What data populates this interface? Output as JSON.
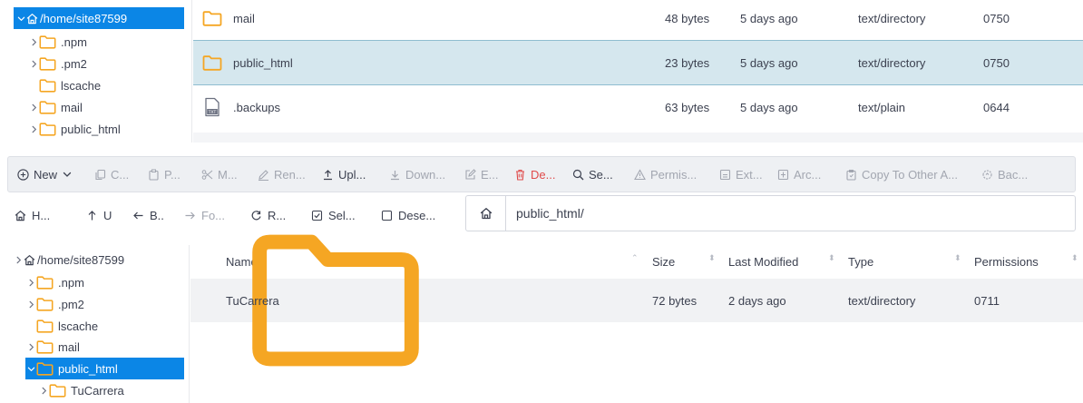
{
  "top_tree": {
    "root": "/home/site87599",
    "items": [
      {
        "label": ".npm",
        "expandable": true
      },
      {
        "label": ".pm2",
        "expandable": true
      },
      {
        "label": "lscache",
        "expandable": false
      },
      {
        "label": "mail",
        "expandable": true
      },
      {
        "label": "public_html",
        "expandable": true
      }
    ]
  },
  "top_list": {
    "rows": [
      {
        "name": "mail",
        "size": "48 bytes",
        "modified": "5 days ago",
        "type": "text/directory",
        "perms": "0750",
        "icon": "folder-icon"
      },
      {
        "name": "public_html",
        "size": "23 bytes",
        "modified": "5 days ago",
        "type": "text/directory",
        "perms": "0750",
        "icon": "folder-icon"
      },
      {
        "name": ".backups",
        "size": "63 bytes",
        "modified": "5 days ago",
        "type": "text/plain",
        "perms": "0644",
        "icon": "text-file-icon"
      }
    ]
  },
  "toolbar": {
    "new": "New",
    "copy": "C...",
    "paste": "P...",
    "move": "M...",
    "rename": "Ren...",
    "upload": "Upl...",
    "download": "Down...",
    "edit": "E...",
    "delete": "De...",
    "search": "Se...",
    "permissions": "Permis...",
    "extract": "Ext...",
    "archive": "Arc...",
    "copy_other": "Copy To Other A...",
    "backup": "Bac..."
  },
  "nav": {
    "home": "H...",
    "up": "U",
    "back": "B..",
    "forward": "Fo...",
    "reload": "R...",
    "select": "Sel...",
    "deselect": "Dese...",
    "path": "public_html/"
  },
  "bottom_tree": {
    "root": "/home/site87599",
    "items": [
      {
        "label": ".npm"
      },
      {
        "label": ".pm2"
      },
      {
        "label": "lscache"
      },
      {
        "label": "mail"
      },
      {
        "label": "public_html"
      },
      {
        "label": "TuCarrera"
      }
    ]
  },
  "table": {
    "headers": {
      "name": "Name",
      "size": "Size",
      "modified": "Last Modified",
      "type": "Type",
      "perms": "Permissions"
    },
    "rows": [
      {
        "name": "TuCarrera",
        "size": "72 bytes",
        "modified": "2 days ago",
        "type": "text/directory",
        "perms": "0711"
      }
    ]
  },
  "colors": {
    "accent": "#0b86e6",
    "folder": "#f5a623",
    "danger": "#e04a4a",
    "selected_row": "#d5e7ee"
  }
}
